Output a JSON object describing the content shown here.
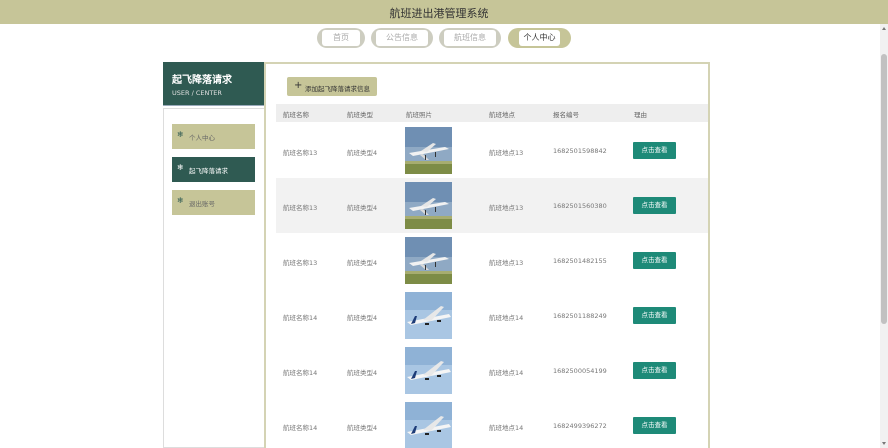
{
  "app": {
    "title": "航班进出港管理系统"
  },
  "nav": {
    "tabs": [
      {
        "label": "首页",
        "active": false
      },
      {
        "label": "公告信息",
        "active": false
      },
      {
        "label": "航班信息",
        "active": false
      },
      {
        "label": "个人中心",
        "active": true
      }
    ]
  },
  "sidebar": {
    "header_title": "起飞降落请求",
    "header_sub": "USER / CENTER",
    "items": [
      {
        "label": "个人中心",
        "icon": "snowflake-icon",
        "active": false
      },
      {
        "label": "起飞降落请求",
        "icon": "snowflake-icon",
        "active": true
      },
      {
        "label": "退出账号",
        "icon": "snowflake-icon",
        "active": false
      }
    ]
  },
  "main": {
    "add_button": "添加起飞降落请求信息",
    "columns": [
      "航班名称",
      "航班类型",
      "航班照片",
      "航班地点",
      "报名编号",
      "理由"
    ],
    "rows": [
      {
        "name": "航班名称13",
        "type": "航班类型4",
        "place": "航班地点13",
        "number": "1682501598842",
        "action": "点击查看",
        "photo": "plane-landing"
      },
      {
        "name": "航班名称13",
        "type": "航班类型4",
        "place": "航班地点13",
        "number": "1682501560380",
        "action": "点击查看",
        "photo": "plane-landing"
      },
      {
        "name": "航班名称13",
        "type": "航班类型4",
        "place": "航班地点13",
        "number": "1682501482155",
        "action": "点击查看",
        "photo": "plane-landing"
      },
      {
        "name": "航班名称14",
        "type": "航班类型4",
        "place": "航班地点14",
        "number": "1682501188249",
        "action": "点击查看",
        "photo": "plane-takeoff"
      },
      {
        "name": "航班名称14",
        "type": "航班类型4",
        "place": "航班地点14",
        "number": "1682500054199",
        "action": "点击查看",
        "photo": "plane-takeoff"
      },
      {
        "name": "航班名称14",
        "type": "航班类型4",
        "place": "航班地点14",
        "number": "1682499396272",
        "action": "点击查看",
        "photo": "plane-takeoff"
      }
    ]
  },
  "colors": {
    "accent": "#c6c598",
    "dark_green": "#2f5a52",
    "button_teal": "#1e8a78"
  }
}
